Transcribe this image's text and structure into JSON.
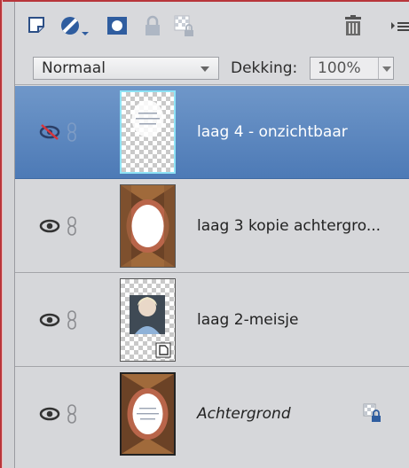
{
  "blend": {
    "mode": "Normaal",
    "opacity_label": "Dekking:",
    "opacity_value": "100%"
  },
  "layers": [
    {
      "name": "laag 4 - onzichtbaar",
      "visible": false,
      "selected": true,
      "thumbnail": "tekst op transparant"
    },
    {
      "name": "laag 3 kopie achtergro...",
      "visible": true,
      "selected": false,
      "thumbnail": "ovale lijst"
    },
    {
      "name": "laag 2-meisje",
      "visible": true,
      "selected": false,
      "thumbnail": "foto meisje"
    },
    {
      "name": "Achtergrond",
      "visible": true,
      "selected": false,
      "thumbnail": "achtergrond met lijst",
      "locked": true
    }
  ],
  "colors": {
    "selected_row": "#5b86bf",
    "accent_frame": "#b8353a",
    "thumb_highlight": "#8fe3f5"
  },
  "icons": [
    "new-layer-icon",
    "adjustment-layer-icon",
    "mask-icon",
    "lock-all-icon",
    "lock-transparency-icon",
    "delete-icon",
    "panel-menu-icon",
    "visibility-icon",
    "link-icon"
  ]
}
